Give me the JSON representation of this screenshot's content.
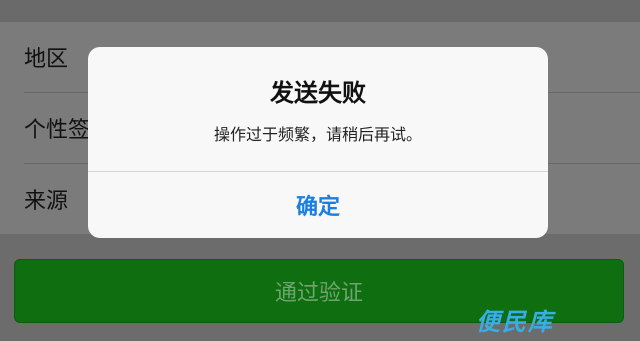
{
  "profile_list": {
    "items": [
      {
        "label": "地区"
      },
      {
        "label": "个性签"
      },
      {
        "label": "来源"
      }
    ]
  },
  "verify_button": {
    "label": "通过验证"
  },
  "alert": {
    "title": "发送失败",
    "message": "操作过于频繁，请稍后再试。",
    "confirm_label": "确定"
  },
  "watermark": {
    "text": "便民库"
  },
  "colors": {
    "overlay": "#6f6f6f",
    "alert_bg": "#f8f8f8",
    "confirm_blue": "#1a7fe0",
    "button_green": "#0f6e0f",
    "watermark_blue": "#38aee6"
  }
}
